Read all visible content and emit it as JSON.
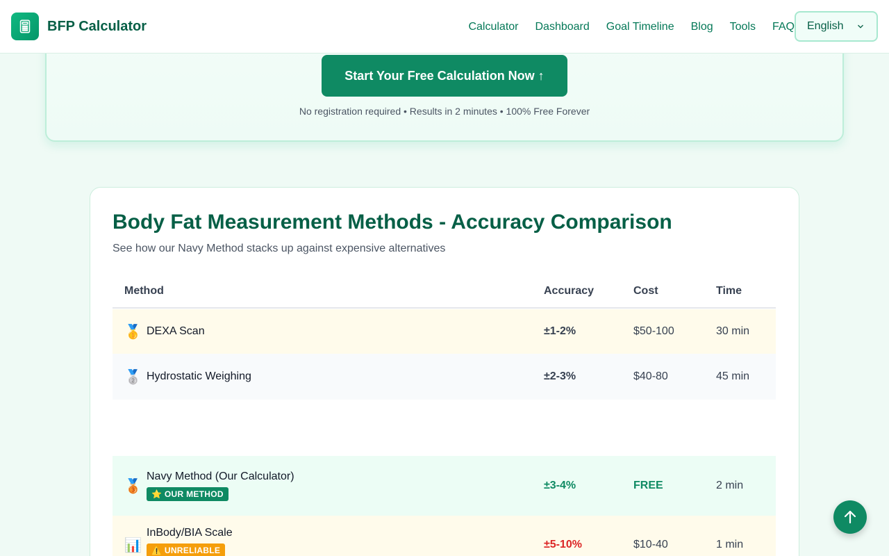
{
  "header": {
    "logo_icon": "calculator-icon",
    "title": "BFP Calculator",
    "nav": [
      "Calculator",
      "Dashboard",
      "Goal Timeline",
      "Blog",
      "Tools",
      "FAQ"
    ],
    "language": "English"
  },
  "cta": {
    "button_label": "Start Your Free Calculation Now ↑",
    "note": "No registration required • Results in 2 minutes • 100% Free Forever"
  },
  "comparison": {
    "title": "Body Fat Measurement Methods - Accuracy Comparison",
    "subtitle": "See how our Navy Method stacks up against expensive alternatives",
    "columns": [
      "Method",
      "Accuracy",
      "Cost",
      "Time"
    ],
    "rows": [
      {
        "icon": "🥇",
        "method": "DEXA Scan",
        "accuracy": "±1-2%",
        "cost": "$50-100",
        "time": "30 min"
      },
      {
        "icon": "🥈",
        "method": "Hydrostatic Weighing",
        "accuracy": "±2-3%",
        "cost": "$40-80",
        "time": "45 min"
      },
      {
        "icon": "🥉",
        "method": "Navy Method (Our Calculator)",
        "badge": "⭐ OUR METHOD",
        "accuracy": "±3-4%",
        "cost": "FREE",
        "time": "2 min"
      },
      {
        "icon": "📊",
        "method": "InBody/BIA Scale",
        "badge": "⚠️ UNRELIABLE",
        "accuracy": "±5-10%",
        "cost": "$10-40",
        "time": "1 min"
      }
    ]
  },
  "colors": {
    "accent": "#0f8a63",
    "title": "#065f46",
    "warning": "#f59e0b",
    "danger": "#dc2626"
  },
  "fab_icon": "arrow-up-icon"
}
